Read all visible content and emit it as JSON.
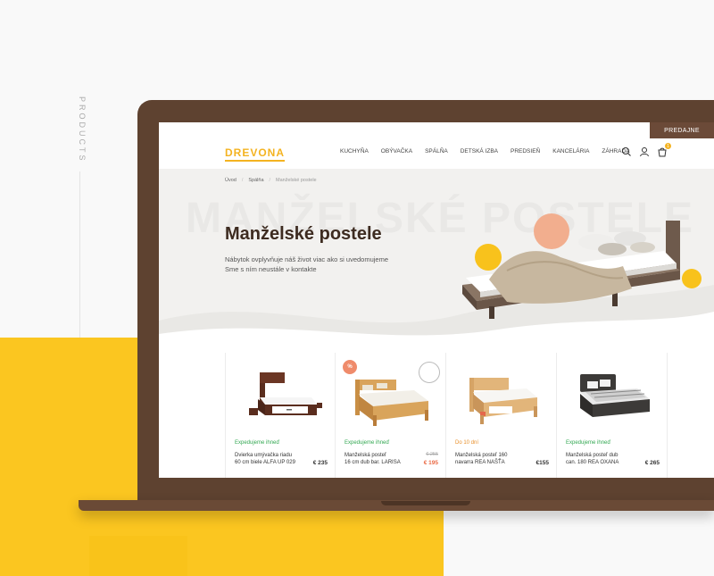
{
  "side_label": "PRODUCTS",
  "header": {
    "logo": "DREVONA",
    "stores_button": "PREDAJNE",
    "cart_count": "1",
    "nav": [
      "KUCHYŇA",
      "OBÝVAČKA",
      "SPÁLŇA",
      "DETSKÁ IZBA",
      "PREDSIEŇ",
      "KANCELÁRIA",
      "ZÁHRADA"
    ]
  },
  "breadcrumb": [
    "Úvod",
    "Spálňa",
    "Manželské postele"
  ],
  "hero": {
    "background_word": "Manželské postele",
    "title": "Manželské postele",
    "text_line1": "Nábytok ovplyvňuje náš život viac ako si uvedomujeme",
    "text_line2": "Sme s ním neustále v kontakte"
  },
  "products": [
    {
      "status": "Expedujeme ihneď",
      "name_line1": "Dvierka umývačka riadu",
      "name_line2": "60 cm biele ALFA UP 029",
      "price": "€ 235"
    },
    {
      "status": "Expedujeme ihneď",
      "name_line1": "Manželská posteľ",
      "name_line2": "16 cm dub bar. LARISA",
      "old_price": "€ 255",
      "price": "€ 195",
      "badge": "%"
    },
    {
      "status": "Do 10 dní",
      "name_line1": "Manželská posteľ 160",
      "name_line2": "navarra REA NAŠŤA",
      "price": "€155"
    },
    {
      "status": "Expedujeme ihneď",
      "name_line1": "Manželská posteľ dub",
      "name_line2": "can. 180 REA OXANA",
      "price": "€ 265"
    }
  ],
  "colors": {
    "brand_yellow": "#f4b321",
    "brown": "#5e4230",
    "sale_red": "#ea6a45",
    "in_stock_green": "#34a853"
  }
}
